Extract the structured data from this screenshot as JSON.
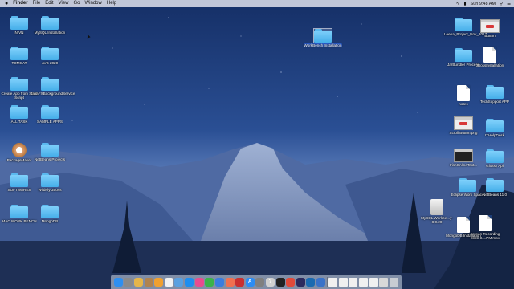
{
  "menubar": {
    "app": "Finder",
    "items": [
      "File",
      "Edit",
      "View",
      "Go",
      "Window",
      "Help"
    ],
    "clock": "Sun 9:48 AM"
  },
  "desktop": {
    "left_icons": [
      {
        "label": "NIVN",
        "kind": "folder"
      },
      {
        "label": "MySQL Installation",
        "kind": "folder"
      },
      {
        "label": "TOMCAT",
        "kind": "folder"
      },
      {
        "label": "AVB 2020",
        "kind": "folder"
      },
      {
        "label": "Create App from Shell Script",
        "kind": "folder"
      },
      {
        "label": "JavaFXBackgroundService",
        "kind": "folder"
      },
      {
        "label": "ALL TASK",
        "kind": "folder"
      },
      {
        "label": "SAMPLE APPS",
        "kind": "folder"
      },
      {
        "label": "PackageMaker",
        "kind": "package"
      },
      {
        "label": "NetBeans Projects",
        "kind": "folder"
      },
      {
        "label": "SOFTWARES",
        "kind": "folder"
      },
      {
        "label": "WildFly-JBoss",
        "kind": "folder"
      },
      {
        "label": "MAC WORK BENCH",
        "kind": "folder"
      },
      {
        "label": "MongoDB",
        "kind": "folder"
      }
    ],
    "center_icon": {
      "label": "WorkBench Installation",
      "kind": "folder"
    },
    "right_icons": [
      {
        "label": "Leena_Project_Nov_2017",
        "kind": "folder"
      },
      {
        "label": "Button",
        "kind": "screenshot-red"
      },
      {
        "label": "JarBundler Process",
        "kind": "folder"
      },
      {
        "label": "JBossInstallation",
        "kind": "doc"
      },
      {
        "label": "notes",
        "kind": "doc"
      },
      {
        "label": "TechSupport APP",
        "kind": "folder"
      },
      {
        "label": "Scroll Button.png",
        "kind": "screenshot-red"
      },
      {
        "label": "ITHelpDesk",
        "kind": "folder"
      },
      {
        "label": "IrishOnlineText...",
        "kind": "screenshot-dark"
      },
      {
        "label": "Glossy Api",
        "kind": "folder"
      },
      {
        "label": "Eclipse Work Space",
        "kind": "folder"
      },
      {
        "label": "NetBeans 11.0",
        "kind": "folder"
      },
      {
        "label": "MySQL Workbe...y-8.0.20",
        "kind": "disk"
      },
      {
        "label": "Screen Recording 2020-0....PM.mov",
        "kind": "doc"
      },
      {
        "label": "MongoDB Installation",
        "kind": "doc"
      }
    ]
  },
  "dock": {
    "apps": [
      {
        "name": "finder-icon",
        "color": "#2e8ff0",
        "glyph": ""
      },
      {
        "name": "launchpad-icon",
        "color": "#8a8a8a",
        "glyph": ""
      },
      {
        "name": "notes-icon",
        "color": "#e5b54a",
        "glyph": ""
      },
      {
        "name": "contacts-icon",
        "color": "#b08350",
        "glyph": ""
      },
      {
        "name": "pages-icon",
        "color": "#f0a030",
        "glyph": ""
      },
      {
        "name": "textedit-icon",
        "color": "#f2f2f2",
        "glyph": ""
      },
      {
        "name": "preview-icon",
        "color": "#5aa0e0",
        "glyph": ""
      },
      {
        "name": "safari-icon",
        "color": "#1e8ef0",
        "glyph": ""
      },
      {
        "name": "itunes-icon",
        "color": "#e94c8f",
        "glyph": ""
      },
      {
        "name": "numbers-icon",
        "color": "#3bb34a",
        "glyph": ""
      },
      {
        "name": "keynote-icon",
        "color": "#3a7de0",
        "glyph": ""
      },
      {
        "name": "photos-icon",
        "color": "#f07050",
        "glyph": ""
      },
      {
        "name": "photo-booth-icon",
        "color": "#c83030",
        "glyph": ""
      },
      {
        "name": "app-store-icon",
        "color": "#2c8cf4",
        "glyph": "A"
      },
      {
        "name": "system-preferences-icon",
        "color": "#808080",
        "glyph": ""
      },
      {
        "name": "help-icon",
        "color": "#d0d0d0",
        "glyph": "?"
      },
      {
        "name": "terminal-icon",
        "color": "#222222",
        "glyph": ""
      },
      {
        "name": "chrome-icon",
        "color": "#e04a3a",
        "glyph": ""
      },
      {
        "name": "eclipse-icon",
        "color": "#2c2a5e",
        "glyph": ""
      },
      {
        "name": "netbeans-icon",
        "color": "#1b6ab0",
        "glyph": ""
      },
      {
        "name": "xcode-icon",
        "color": "#3a72c8",
        "glyph": ""
      }
    ],
    "docs": [
      {
        "name": "recent-doc-1-icon",
        "color": "#f0f0f0"
      },
      {
        "name": "recent-doc-2-icon",
        "color": "#f0f0f0"
      },
      {
        "name": "recent-doc-3-icon",
        "color": "#f0f0f0"
      },
      {
        "name": "recent-doc-4-icon",
        "color": "#f0f0f0"
      },
      {
        "name": "recent-doc-5-icon",
        "color": "#f0f0f0"
      },
      {
        "name": "downloads-stack-icon",
        "color": "#d8d8d8"
      },
      {
        "name": "trash-icon",
        "color": "#c8ccd2"
      }
    ]
  }
}
